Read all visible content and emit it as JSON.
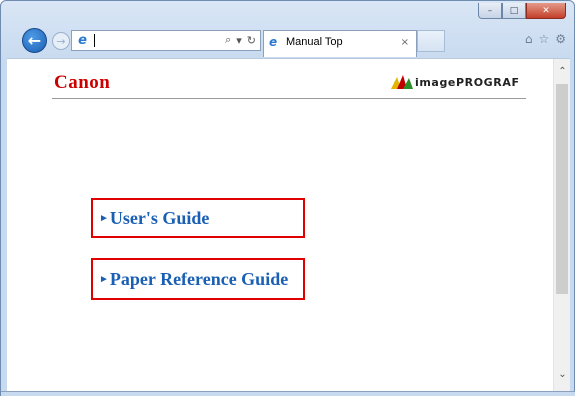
{
  "browser": {
    "tab_title": "Manual Top",
    "tab_close": "×",
    "caption": {
      "minimize": "–",
      "maximize": "□",
      "close": "✕"
    },
    "nav": {
      "back": "←",
      "forward": "→"
    },
    "address": {
      "value": "",
      "search_icon": "⌕",
      "dropdown": "▾",
      "refresh": "↻"
    },
    "toolbar_icons": [
      "⌂",
      "☆",
      "⚙"
    ]
  },
  "page": {
    "brand_logo": "Canon",
    "product_logo": "imagePROGRAF",
    "links": [
      {
        "label": "User's Guide",
        "arrow": "►"
      },
      {
        "label": "Paper Reference Guide",
        "arrow": "►"
      }
    ]
  },
  "scrollbar": {
    "up": "⌃",
    "down": "⌄"
  },
  "colors": {
    "link_text": "#1a5fb4",
    "link_border": "#e00000",
    "canon_red": "#cc0000"
  }
}
